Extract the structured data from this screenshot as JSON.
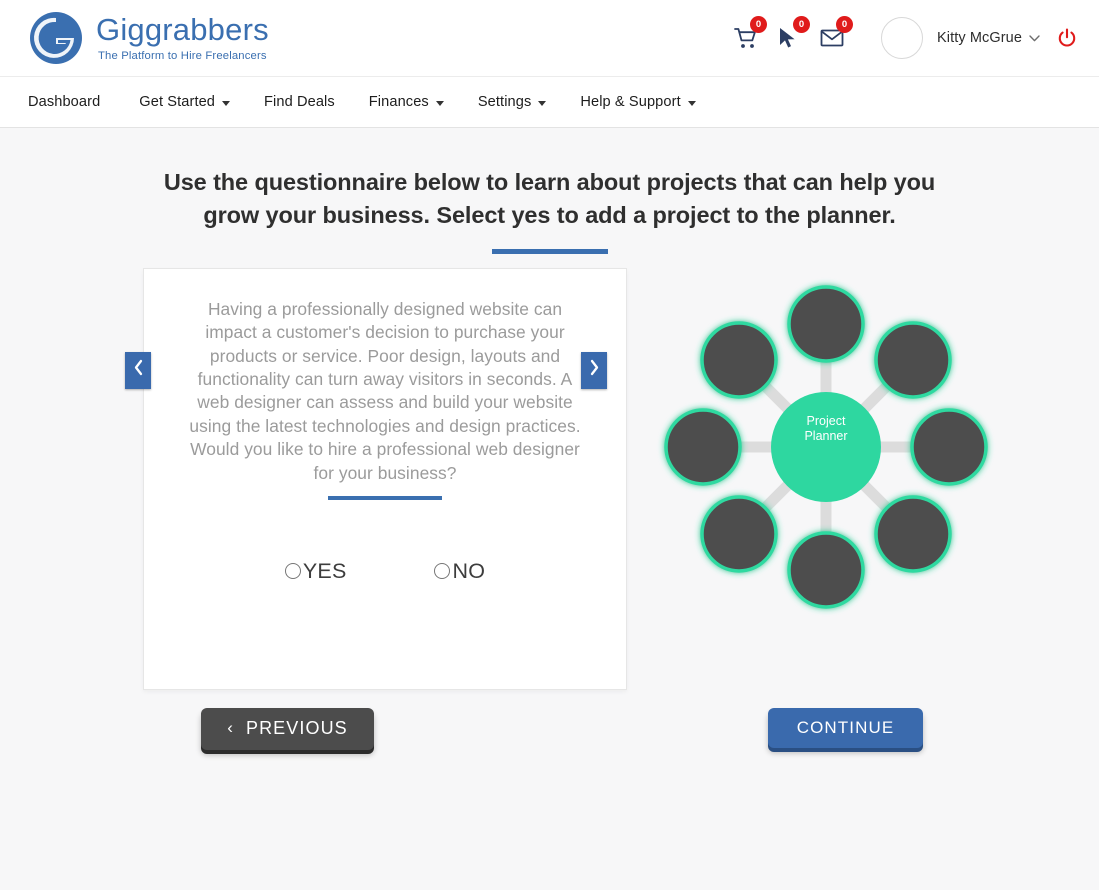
{
  "brand": {
    "name": "Giggrabbers",
    "tagline": "The Platform to Hire Freelancers",
    "logo_color": "#3a6fb0"
  },
  "topbar": {
    "icons": [
      {
        "name": "cart-icon",
        "badge": "0"
      },
      {
        "name": "bid-icon",
        "badge": "0"
      },
      {
        "name": "mail-icon",
        "badge": "0"
      }
    ],
    "user": {
      "name": "Kitty McGrue",
      "caret": "⌄",
      "avatar_alt": "avatar"
    },
    "power": {
      "name": "power-icon",
      "color": "#e01b1b"
    }
  },
  "nav": {
    "items": [
      {
        "label": "Dashboard",
        "has_dropdown": false
      },
      {
        "label": "Get Started",
        "has_dropdown": true
      },
      {
        "label": "Find Deals",
        "has_dropdown": false
      },
      {
        "label": "Finances",
        "has_dropdown": true
      },
      {
        "label": "Settings",
        "has_dropdown": true
      },
      {
        "label": "Help & Support",
        "has_dropdown": true
      }
    ]
  },
  "page": {
    "headline": "Use the questionnaire below to learn about projects that can help you grow your business. Select yes to add a project to the planner.",
    "accent_color": "#3a6fb0"
  },
  "question_card": {
    "text": "Having a professionally designed website can impact a customer's decision to purchase your products or service. Poor design, layouts and functionality can turn away visitors in seconds. A web designer can assess and build your website using the latest technologies and design practices. Would you like to hire a professional web designer for your business?",
    "answers": [
      {
        "value": "yes",
        "label": "YES",
        "selected": false
      },
      {
        "value": "no",
        "label": "NO",
        "selected": false
      }
    ],
    "prev_arrow": "‹",
    "next_arrow": "›"
  },
  "diagram": {
    "center_label_line1": "Project",
    "center_label_line2": "Planner",
    "center_color": "#2ed7a0",
    "node_color": "#4e4e4e",
    "node_ring_color": "#2fd9a0",
    "spoke_color": "#dcdcdc",
    "node_count": 8
  },
  "footer": {
    "previous_label": "PREVIOUS",
    "previous_chevron": "‹",
    "continue_label": "CONTINUE"
  }
}
